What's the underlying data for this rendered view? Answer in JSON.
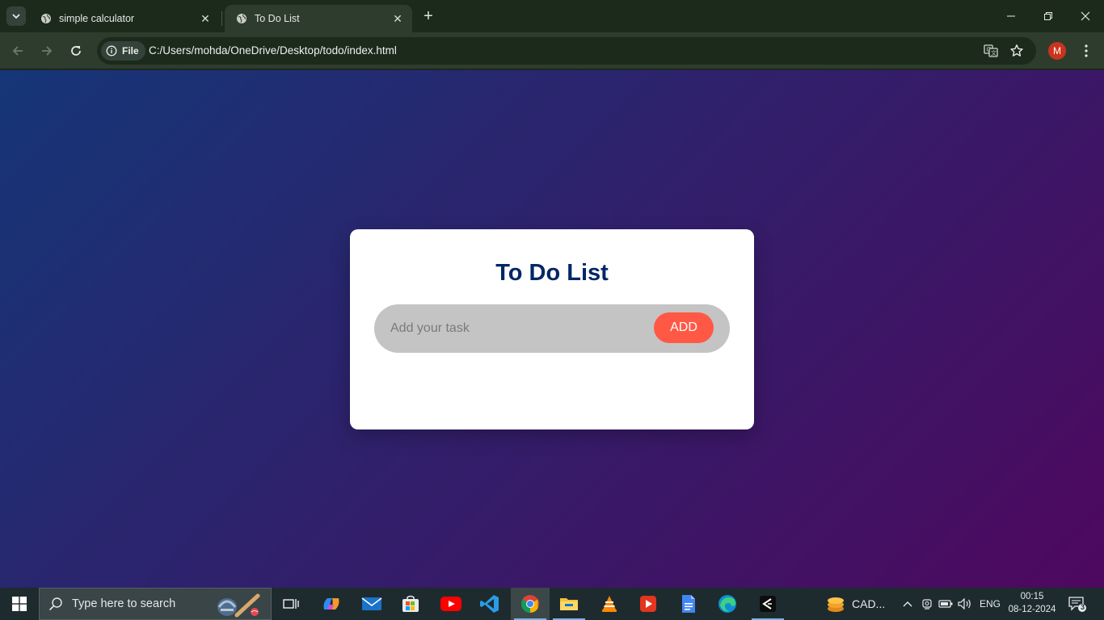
{
  "browser": {
    "tabs": [
      {
        "title": "simple calculator",
        "active": false
      },
      {
        "title": "To Do List",
        "active": true
      }
    ],
    "new_tab_symbol": "+",
    "site_chip_label": "File",
    "url": "C:/Users/mohda/OneDrive/Desktop/todo/index.html",
    "profile_initial": "M",
    "accent_color": "#2e3c2e"
  },
  "page": {
    "title": "To Do List",
    "input_placeholder": "Add your task",
    "input_value": "",
    "add_button_label": "ADD",
    "colors": {
      "gradient_start": "#153677",
      "gradient_end": "#4e085f",
      "title": "#002765",
      "button": "#ff5945",
      "input_bg": "#c4c4c4"
    }
  },
  "taskbar": {
    "search_placeholder": "Type here to search",
    "pinned_apps": [
      "task-view",
      "copilot",
      "mail",
      "microsoft-store",
      "youtube",
      "vscode",
      "chrome",
      "file-explorer",
      "vlc",
      "slides-app",
      "google-docs",
      "edge",
      "cursor-app"
    ],
    "active_app": "chrome",
    "tray_currency_label": "CAD...",
    "language": "ENG",
    "time": "00:15",
    "date": "08-12-2024",
    "notification_count": "3"
  }
}
